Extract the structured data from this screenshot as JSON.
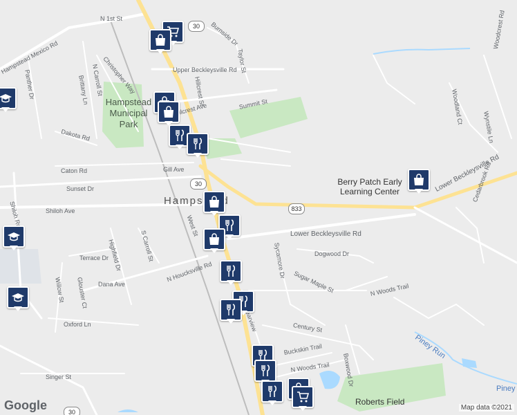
{
  "map": {
    "attribution": "Map data ©2021",
    "logo": "Google",
    "area_label": "Hampstead",
    "park_label": "Hampstead Municipal Park",
    "poi_berry": "Berry Patch Early Learning Center",
    "poi_roberts": "Roberts Field",
    "routes": [
      "30",
      "833",
      "30"
    ],
    "streets": [
      "N 1st St",
      "Burnside Dr",
      "Taylor St",
      "Upper Beckleysville Rd",
      "Hillcrest St",
      "Hillcrest Ave",
      "Summit St",
      "Hampstead Mexico Rd",
      "N Carroll St",
      "Christopher Way",
      "Brittany Ln",
      "Panther Dr",
      "Dakota Rd",
      "Caton Rd",
      "Gill Ave",
      "Sunset Dr",
      "Shiloh Ave",
      "Shiloh Rd",
      "Lower Beckleysville Rd",
      "Lower Beckleysville Rd",
      "Sycamore Dr",
      "Dogwood Dr",
      "Sugar Maple St",
      "N Woods Trail",
      "Terrace Dr",
      "Highfield Dr",
      "S Carroll St",
      "West St",
      "N Houcksville Rd",
      "Dana Ave",
      "Glouster Ct",
      "Willow St",
      "Oxford Ln",
      "Clearview",
      "Century St",
      "Buckskin Trail",
      "N Woods Trail",
      "Boxwood Dr",
      "Singer St",
      "Piney Run",
      "Piney",
      "Cedarbrook Rd",
      "Woodland Ct",
      "Wynstile Ln",
      "Woodcrest Rd"
    ]
  },
  "markers": [
    {
      "icon": "shopping-cart-icon",
      "label": "grocery"
    },
    {
      "icon": "shopping-bag-icon",
      "label": "shop"
    },
    {
      "icon": "shopping-bag-icon",
      "label": "shop"
    },
    {
      "icon": "restaurant-icon",
      "label": "restaurant"
    },
    {
      "icon": "restaurant-icon",
      "label": "restaurant"
    },
    {
      "icon": "shopping-bag-icon",
      "label": "shop"
    },
    {
      "icon": "restaurant-icon",
      "label": "restaurant"
    },
    {
      "icon": "shopping-bag-icon",
      "label": "shop"
    },
    {
      "icon": "restaurant-icon",
      "label": "restaurant"
    },
    {
      "icon": "restaurant-icon",
      "label": "restaurant"
    },
    {
      "icon": "restaurant-icon",
      "label": "restaurant"
    },
    {
      "icon": "restaurant-icon",
      "label": "restaurant"
    },
    {
      "icon": "restaurant-icon",
      "label": "restaurant"
    },
    {
      "icon": "restaurant-icon",
      "label": "restaurant"
    },
    {
      "icon": "restaurant-icon",
      "label": "restaurant"
    },
    {
      "icon": "shopping-cart-icon",
      "label": "grocery"
    },
    {
      "icon": "shopping-bag-icon",
      "label": "shop"
    },
    {
      "icon": "school-icon",
      "label": "school"
    },
    {
      "icon": "school-icon",
      "label": "school"
    },
    {
      "icon": "school-icon",
      "label": "school"
    }
  ],
  "colors": {
    "marker_fill": "#1f3a6a",
    "park": "#c8e6c0",
    "water": "#aadaff",
    "road": "#ffffff",
    "highway": "#fde293"
  }
}
